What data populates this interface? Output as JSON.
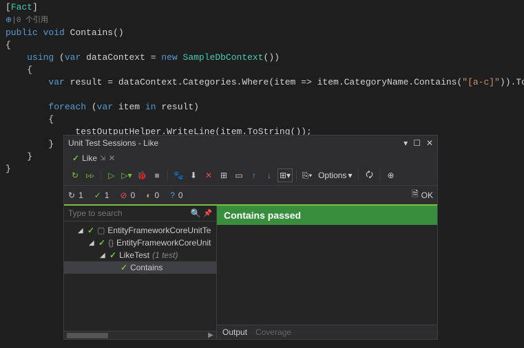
{
  "code": {
    "attr": "Fact",
    "refs_prefix": "|0 ",
    "refs_text": "个引用",
    "kw_public": "public",
    "kw_void": "void",
    "method": "Contains",
    "kw_using": "using",
    "kw_var": "var",
    "var_dc": "dataContext",
    "kw_new": "new",
    "class_sample": "SampleDbContext",
    "var_result": "result",
    "prop_categories": "Categories",
    "method_where": "Where",
    "param_item": "item",
    "prop_catname": "CategoryName",
    "method_contains": "Contains",
    "string_pattern": "\"[a-c]\"",
    "method_tolist": "ToList",
    "kw_foreach": "foreach",
    "kw_in": "in",
    "var_item": "item",
    "field_helper": "_testOutputHelper",
    "method_writeline": "WriteLine",
    "method_tostring": "ToString"
  },
  "panel": {
    "title": "Unit Test Sessions - Like",
    "tab_label": "Like",
    "options_label": "Options",
    "counters": {
      "running": "1",
      "success": "1",
      "fail": "0",
      "ignore": "0",
      "unknown": "0",
      "ok": "OK"
    },
    "search_placeholder": "Type to search",
    "tree": {
      "root": "EntityFrameworkCoreUnitTe",
      "ns": "EntityFrameworkCoreUnit",
      "class": "LikeTest",
      "class_suffix": "(1 test)",
      "test": "Contains"
    },
    "result_header": "Contains passed",
    "footer_output": "Output",
    "footer_coverage": "Coverage"
  }
}
